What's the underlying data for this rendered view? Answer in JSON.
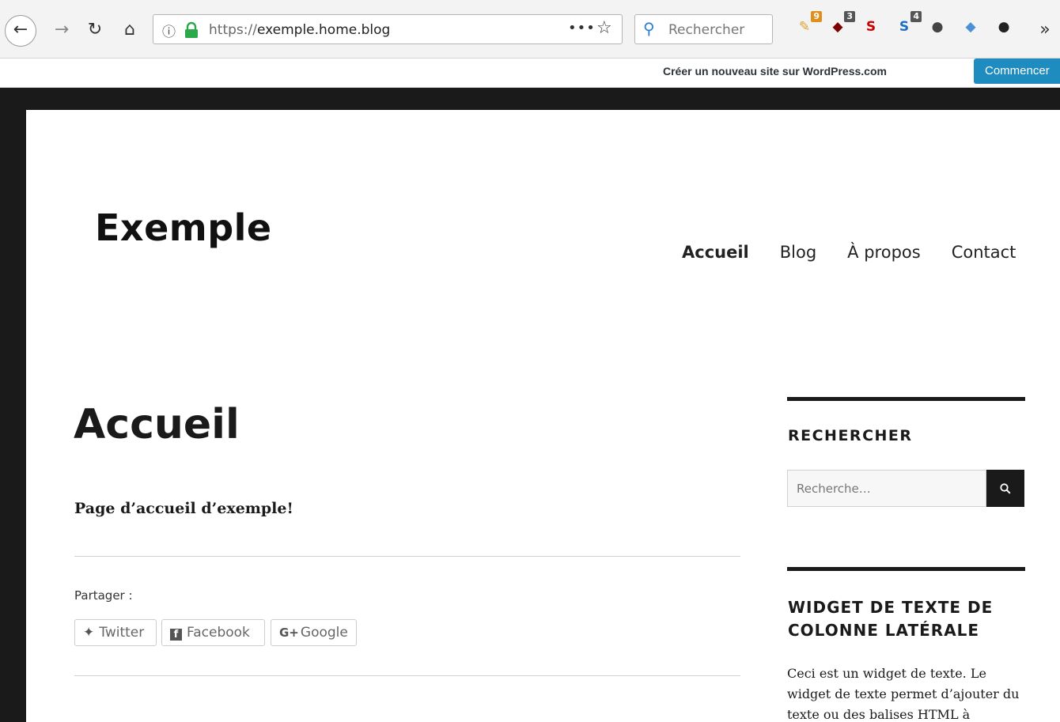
{
  "browser": {
    "url_protocol": "https://",
    "url_host": "exemple.home.blog",
    "search_placeholder": "Rechercher",
    "extensions": [
      {
        "name": "extension-1-icon",
        "badge": "9",
        "color": "#e0a030"
      },
      {
        "name": "ublock-icon",
        "badge": "3",
        "color": "#800000"
      },
      {
        "name": "s-red-icon",
        "badge": "",
        "color": "#c00"
      },
      {
        "name": "s-blue-icon",
        "badge": "4",
        "color": "#1a6fc4"
      },
      {
        "name": "extension-5-icon",
        "badge": "",
        "color": "#444"
      },
      {
        "name": "extension-6-icon",
        "badge": "",
        "color": "#4a8fd8"
      },
      {
        "name": "extension-7-icon",
        "badge": "",
        "color": "#222"
      }
    ],
    "overflow": "»"
  },
  "wpbar": {
    "create_site": "Créer un nouveau site sur WordPress.com",
    "start_button": "Commencer"
  },
  "site": {
    "title": "Exemple",
    "nav": [
      "Accueil",
      "Blog",
      "À propos",
      "Contact"
    ]
  },
  "entry": {
    "title": "Accueil",
    "content": "Page d’accueil d’exemple!",
    "share_label": "Partager :",
    "share_buttons": [
      "Twitter",
      "Facebook",
      "Google"
    ]
  },
  "sidebar": {
    "search_title": "RECHERCHER",
    "search_placeholder": "Recherche…",
    "text_widget_title": "WIDGET DE TEXTE DE COLONNE LATÉRALE",
    "text_widget_body": "Ceci est un widget de texte. Le widget de texte permet d’ajouter du texte ou des balises HTML à"
  }
}
